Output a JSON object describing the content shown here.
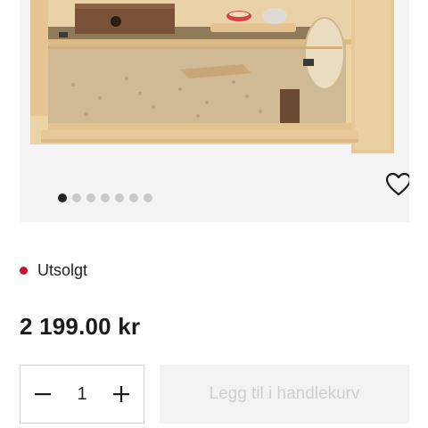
{
  "product_image": {
    "alt_icon": "hamster-cage-photo",
    "slide_count": 7,
    "active_slide": 0
  },
  "favorite": {
    "icon": "heart-icon"
  },
  "stock": {
    "label": "Utsolgt",
    "color": "#c8102e"
  },
  "price": {
    "label": "2 199.00 kr"
  },
  "quantity": {
    "value": "1",
    "minus_icon": "minus-icon",
    "plus_icon": "plus-icon"
  },
  "cart_button": {
    "label": "Legg til i handlekurv",
    "disabled": true
  }
}
